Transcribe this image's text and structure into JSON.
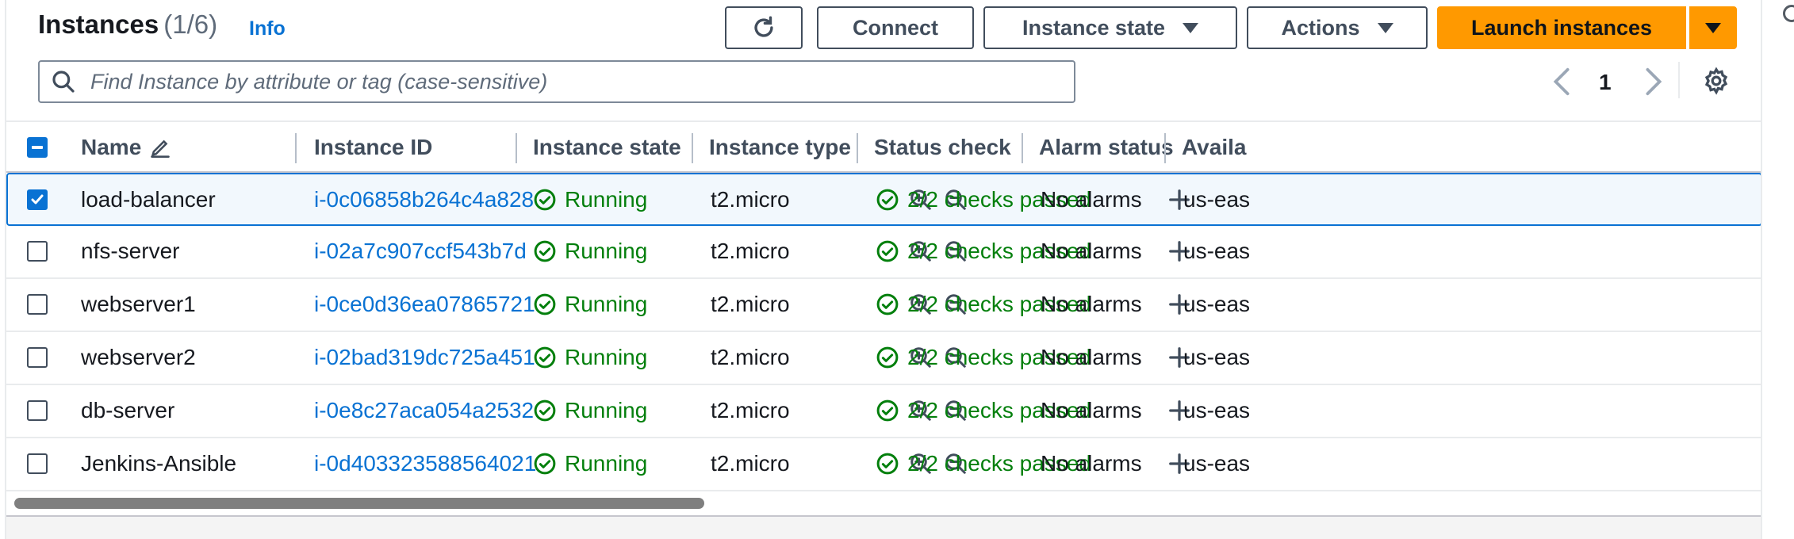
{
  "header": {
    "title": "Instances",
    "count": "(1/6)",
    "info": "Info",
    "connect_label": "Connect",
    "instance_state_label": "Instance state",
    "actions_label": "Actions",
    "launch_label": "Launch instances"
  },
  "search": {
    "placeholder": "Find Instance by attribute or tag (case-sensitive)"
  },
  "pagination": {
    "page": "1"
  },
  "table": {
    "columns": [
      "Name",
      "Instance ID",
      "Instance state",
      "Instance type",
      "Status check",
      "Alarm status",
      "Availa"
    ],
    "rows": [
      {
        "name": "load-balancer",
        "id": "i-0c06858b264c4a828",
        "state": "Running",
        "type": "t2.micro",
        "status": "2/2 checks passed",
        "alarm": "No alarms",
        "az": "us-eas",
        "selected": true
      },
      {
        "name": "nfs-server",
        "id": "i-02a7c907ccf543b7d",
        "state": "Running",
        "type": "t2.micro",
        "status": "2/2 checks passed",
        "alarm": "No alarms",
        "az": "us-eas",
        "selected": false
      },
      {
        "name": "webserver1",
        "id": "i-0ce0d36ea07865721",
        "state": "Running",
        "type": "t2.micro",
        "status": "2/2 checks passed",
        "alarm": "No alarms",
        "az": "us-eas",
        "selected": false
      },
      {
        "name": "webserver2",
        "id": "i-02bad319dc725a451",
        "state": "Running",
        "type": "t2.micro",
        "status": "2/2 checks passed",
        "alarm": "No alarms",
        "az": "us-eas",
        "selected": false
      },
      {
        "name": "db-server",
        "id": "i-0e8c27aca054a2532",
        "state": "Running",
        "type": "t2.micro",
        "status": "2/2 checks passed",
        "alarm": "No alarms",
        "az": "us-eas",
        "selected": false
      },
      {
        "name": "Jenkins-Ansible",
        "id": "i-0d403323588564021",
        "state": "Running",
        "type": "t2.micro",
        "status": "2/2 checks passed",
        "alarm": "No alarms",
        "az": "us-eas",
        "selected": false
      }
    ]
  },
  "colors": {
    "accent": "#0972d3",
    "launch": "#ff9900",
    "success": "#037f0c"
  },
  "icons": [
    "refresh-icon",
    "caret-down-icon",
    "search-icon",
    "chevron-left-icon",
    "chevron-right-icon",
    "gear-icon",
    "edit-pencil-icon",
    "sort-icon",
    "check-circle-icon",
    "zoom-in-icon",
    "zoom-out-icon",
    "plus-icon"
  ]
}
